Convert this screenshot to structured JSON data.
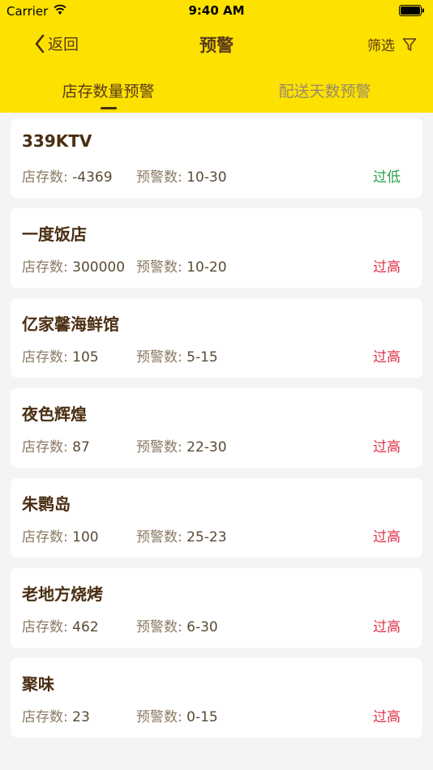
{
  "status_bar": {
    "carrier": "Carrier",
    "time": "9:40 AM"
  },
  "nav": {
    "back_label": "返回",
    "title": "预警",
    "filter_label": "筛选"
  },
  "tabs": [
    {
      "label": "店存数量预警"
    },
    {
      "label": "配送天数预警"
    }
  ],
  "labels": {
    "stock": "店存数:",
    "warning": "预警数:"
  },
  "colors": {
    "header_bg": "#fde100",
    "low": "#2aa04a",
    "high": "#e0304a"
  },
  "items": [
    {
      "name": "339KTV",
      "stock": "-4369",
      "warning": "10-30",
      "status": "过低",
      "status_type": "low"
    },
    {
      "name": "一度饭店",
      "stock": "300000",
      "warning": "10-20",
      "status": "过高",
      "status_type": "high"
    },
    {
      "name": "亿家馨海鲜馆",
      "stock": "105",
      "warning": "5-15",
      "status": "过高",
      "status_type": "high"
    },
    {
      "name": "夜色辉煌",
      "stock": "87",
      "warning": "22-30",
      "status": "过高",
      "status_type": "high"
    },
    {
      "name": "朱鹮岛",
      "stock": "100",
      "warning": "25-23",
      "status": "过高",
      "status_type": "high"
    },
    {
      "name": "老地方烧烤",
      "stock": "462",
      "warning": "6-30",
      "status": "过高",
      "status_type": "high"
    },
    {
      "name": "聚味",
      "stock": "23",
      "warning": "0-15",
      "status": "过高",
      "status_type": "high"
    }
  ]
}
